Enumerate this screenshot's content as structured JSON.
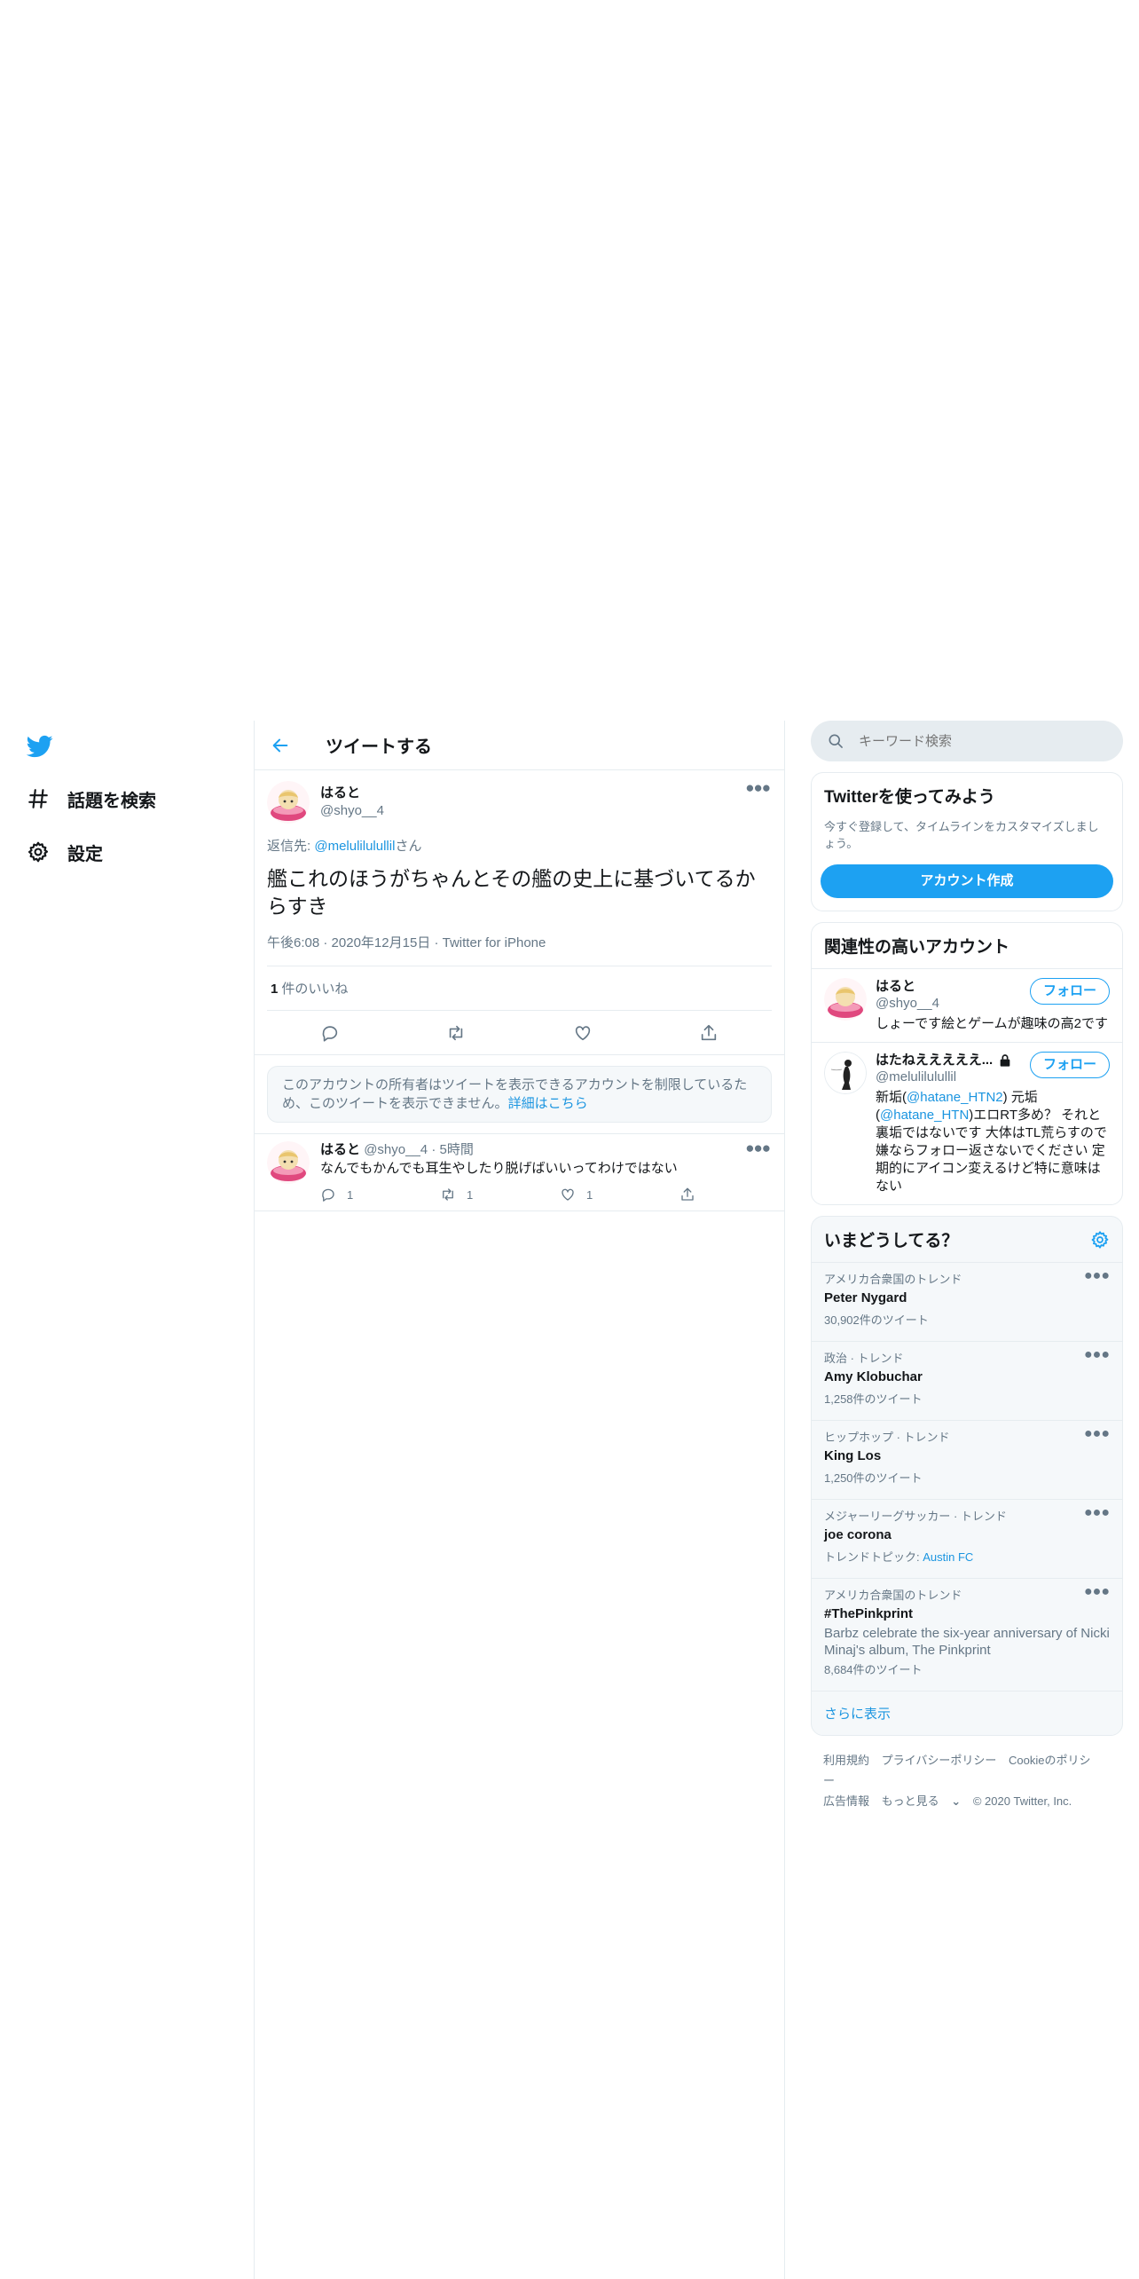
{
  "colors": {
    "accent": "#1da1f2",
    "link": "#1b95e0",
    "muted": "#657786",
    "border": "#e6ecf0"
  },
  "nav": {
    "logo_icon": "twitter-bird-icon",
    "explore_label": "話題を検索",
    "settings_label": "設定"
  },
  "header": {
    "title": "ツイートする"
  },
  "focal_tweet": {
    "name": "はると",
    "handle": "@shyo__4",
    "reply_prefix": "返信先: ",
    "reply_handle": "@melulilulullil",
    "reply_suffix": "さん",
    "text": "艦これのほうがちゃんとその艦の史上に基づいてるからすき",
    "time": "午後6:08",
    "date": "2020年12月15日",
    "source": "Twitter for iPhone",
    "like_count": "1",
    "like_label": "件のいいね"
  },
  "notice": {
    "text": "このアカウントの所有者はツイートを表示できるアカウントを制限しているため、このツイートを表示できません。",
    "link": "詳細はこちら"
  },
  "reply": {
    "name": "はると",
    "handle": "@shyo__4",
    "age": "5時間",
    "text": "なんでもかんでも耳生やしたり脱げばいいってわけではない",
    "replies": "1",
    "retweets": "1",
    "likes": "1"
  },
  "search": {
    "placeholder": "キーワード検索"
  },
  "signup": {
    "title": "Twitterを使ってみよう",
    "text": "今すぐ登録して、タイムラインをカスタマイズしましょう。",
    "button": "アカウント作成"
  },
  "relevant": {
    "title": "関連性の高いアカウント",
    "follow_label": "フォロー",
    "accounts": [
      {
        "name": "はると",
        "handle": "@shyo__4",
        "bio": "しょーです絵とゲームが趣味の高2です"
      },
      {
        "name": "はたねえええええ...",
        "handle": "@melulilulullil",
        "bio_pre": "新垢(",
        "bio_link1": "@hatane_HTN2",
        "bio_mid": ") 元垢(",
        "bio_link2": "@hatane_HTN",
        "bio_post": ")エロRT多め？ それと裏垢ではないです 大体はTL荒らすので嫌ならフォロー返さないでください 定期的にアイコン変えるけど特に意味はない"
      }
    ]
  },
  "trends": {
    "title": "いまどうしてる？",
    "items": [
      {
        "category": "アメリカ合衆国のトレンド",
        "name": "Peter Nygard",
        "count": "30,902件のツイート"
      },
      {
        "category": "政治 · トレンド",
        "name": "Amy Klobuchar",
        "count": "1,258件のツイート"
      },
      {
        "category": "ヒップホップ · トレンド",
        "name": "King Los",
        "count": "1,250件のツイート"
      },
      {
        "category": "メジャーリーグサッカー · トレンド",
        "name": "joe corona",
        "topic_label": "トレンドトピック: ",
        "topic_link": "Austin FC"
      },
      {
        "category": "アメリカ合衆国のトレンド",
        "name": "#ThePinkprint",
        "desc": "Barbz celebrate the six-year anniversary of Nicki Minaj's album, The Pinkprint",
        "count": "8,684件のツイート"
      }
    ],
    "show_more": "さらに表示"
  },
  "footer": {
    "terms": "利用規約",
    "privacy": "プライバシーポリシー",
    "cookie": "Cookieのポリシー",
    "ads": "広告情報",
    "more": "もっと見る",
    "copyright": "© 2020 Twitter, Inc."
  }
}
